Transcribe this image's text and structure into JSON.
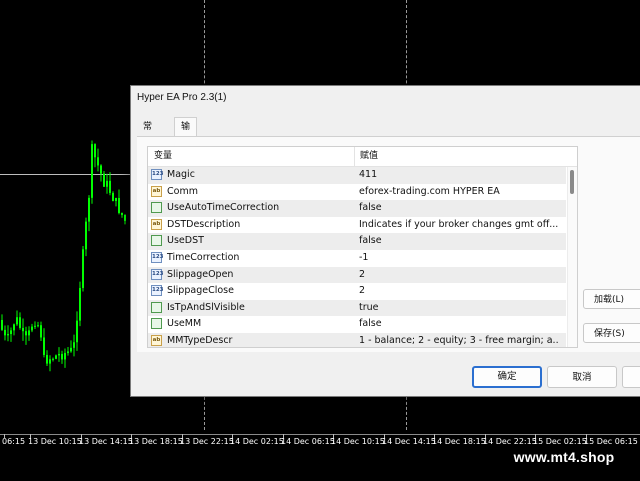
{
  "dialog": {
    "title": "Hyper EA Pro 2.3(1)",
    "tabs": [
      "常用",
      "输入参数"
    ],
    "active_tab": "输入参数",
    "table": {
      "columns": [
        "变量",
        "赋值"
      ],
      "rows": [
        {
          "icon": "int",
          "icon_text": "123",
          "name": "Magic",
          "value": "411"
        },
        {
          "icon": "str",
          "icon_text": "ab",
          "name": "Comm",
          "value": "eforex-trading.com HYPER EA"
        },
        {
          "icon": "bool",
          "icon_text": "",
          "name": "UseAutoTimeCorrection",
          "value": "false"
        },
        {
          "icon": "str",
          "icon_text": "ab",
          "name": "DSTDescription",
          "value": "Indicates if your broker changes gmt off..."
        },
        {
          "icon": "bool",
          "icon_text": "",
          "name": "UseDST",
          "value": "false"
        },
        {
          "icon": "int",
          "icon_text": "123",
          "name": "TimeCorrection",
          "value": "-1"
        },
        {
          "icon": "int",
          "icon_text": "123",
          "name": "SlippageOpen",
          "value": "2"
        },
        {
          "icon": "int",
          "icon_text": "123",
          "name": "SlippageClose",
          "value": "2"
        },
        {
          "icon": "bool",
          "icon_text": "",
          "name": "IsTpAndSlVisible",
          "value": "true"
        },
        {
          "icon": "bool",
          "icon_text": "",
          "name": "UseMM",
          "value": "false"
        },
        {
          "icon": "str",
          "icon_text": "ab",
          "name": "MMTypeDescr",
          "value": "1 - balance; 2 - equity; 3 - free margin; a..."
        }
      ]
    },
    "side_buttons": {
      "load": "加载(L)",
      "save": "保存(S)"
    },
    "buttons": {
      "ok": "确定",
      "cancel": "取消"
    }
  },
  "time_axis": {
    "labels": [
      "06:15",
      "13 Dec 10:15",
      "13 Dec 14:15",
      "13 Dec 18:15",
      "13 Dec 22:15",
      "14 Dec 02:15",
      "14 Dec 06:15",
      "14 Dec 10:15",
      "14 Dec 14:15",
      "14 Dec 18:15",
      "14 Dec 22:15",
      "15 Dec 02:15",
      "15 Dec 06:15"
    ]
  },
  "watermark": "www.mt4.shop",
  "colors": {
    "candle": "#00ff00",
    "chart_bg": "#000000",
    "accent": "#2b6fd0"
  }
}
